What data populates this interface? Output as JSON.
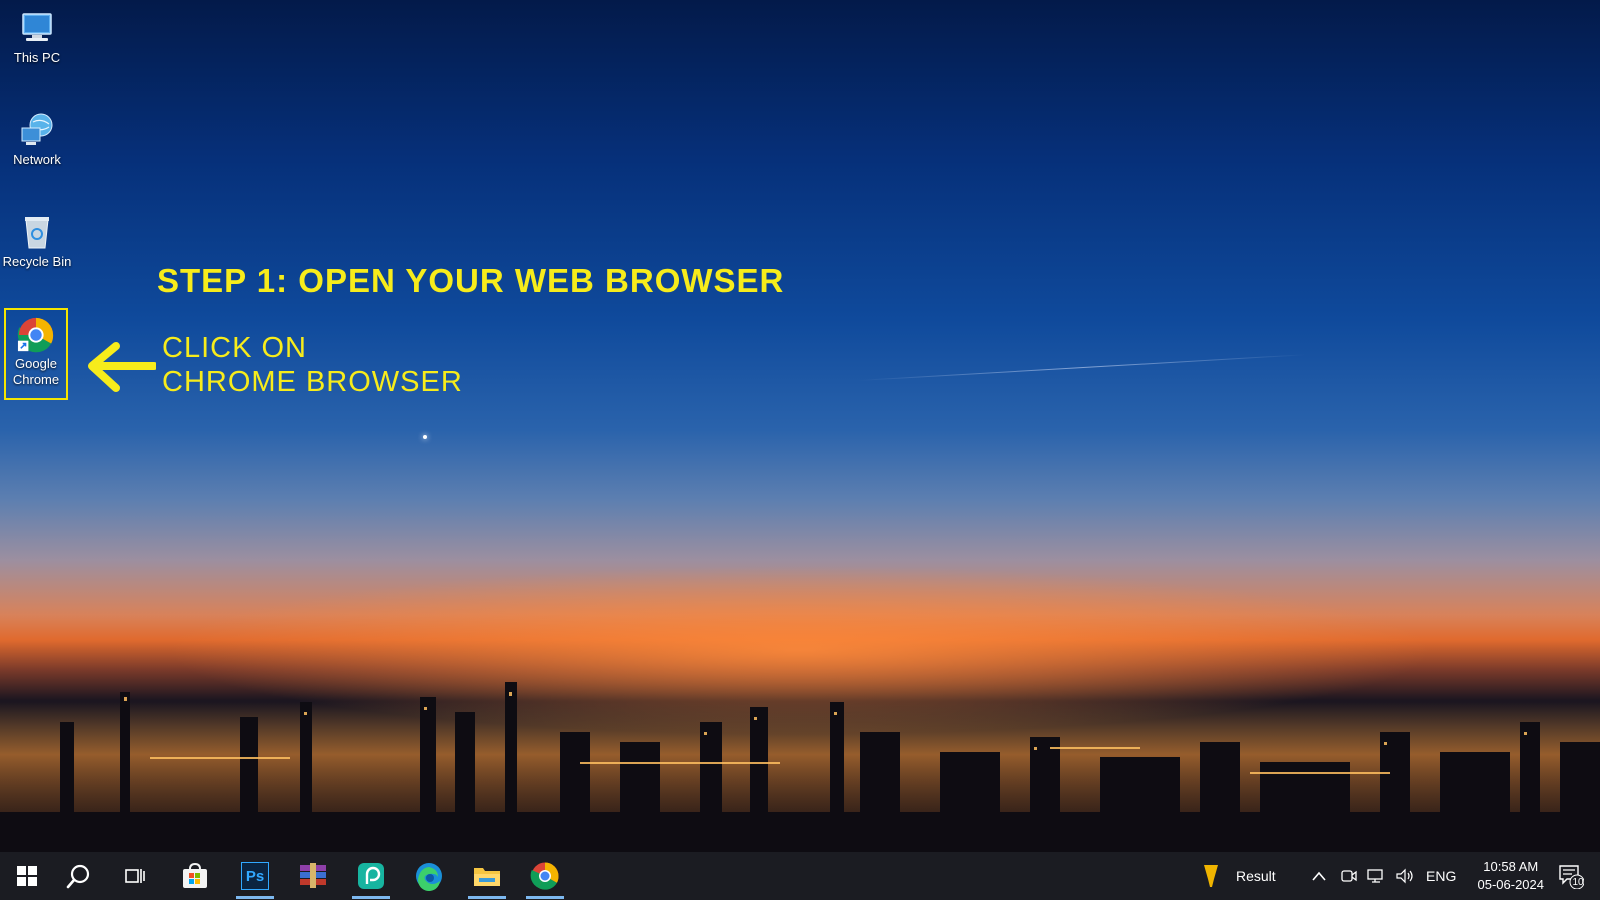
{
  "desktop": {
    "icons": [
      {
        "label": "This PC",
        "icon": "this-pc-icon"
      },
      {
        "label": "Network",
        "icon": "network-icon"
      },
      {
        "label": "Recycle Bin",
        "icon": "recycle-bin-icon"
      },
      {
        "label_line1": "Google",
        "label_line2": "Chrome",
        "icon": "chrome-icon"
      }
    ]
  },
  "annotation": {
    "title": "STEP 1: OPEN YOUR WEB BROWSER",
    "line1": "CLICK ON",
    "line2": "CHROME BROWSER",
    "color": "#f7ec1b"
  },
  "taskbar": {
    "apps": [
      {
        "name": "start",
        "icon": "windows-icon"
      },
      {
        "name": "search",
        "icon": "search-icon"
      },
      {
        "name": "task-view",
        "icon": "task-view-icon"
      },
      {
        "name": "microsoft-store",
        "icon": "store-icon"
      },
      {
        "name": "photoshop",
        "icon": "photoshop-icon",
        "label": "Ps"
      },
      {
        "name": "winrar",
        "icon": "winrar-icon"
      },
      {
        "name": "picsart",
        "icon": "picsart-icon"
      },
      {
        "name": "edge",
        "icon": "edge-icon"
      },
      {
        "name": "file-explorer",
        "icon": "folder-icon"
      },
      {
        "name": "chrome",
        "icon": "chrome-icon"
      }
    ],
    "weather_label": "Result",
    "language": "ENG",
    "time": "10:58 AM",
    "date": "05-06-2024",
    "notification_count": "10"
  }
}
